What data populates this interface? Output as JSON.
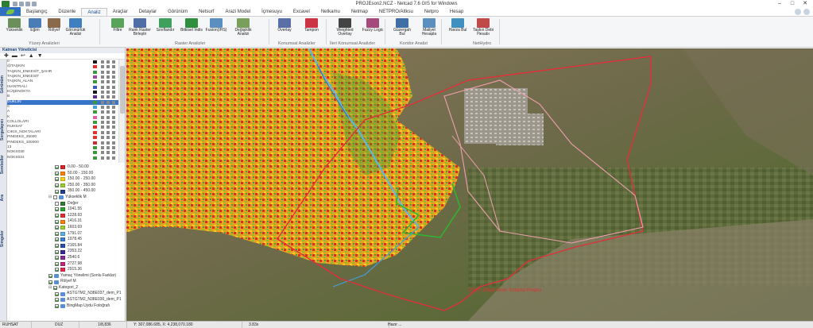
{
  "window": {
    "title": "PROJEson2.NCZ - Netcad 7.6 GIS for Windows"
  },
  "menu": {
    "tabs": [
      "Başlangıç",
      "Düzenle",
      "Analiz",
      "Araçlar",
      "Detaylar",
      "Görünüm",
      "Netsurf",
      "Arazi Model",
      "İçmesuyu",
      "Excavel",
      "Netkamu",
      "Netmap",
      "NETPRO/Altksu",
      "Netpro",
      "Hesap"
    ],
    "active": "Analiz"
  },
  "ribbon": {
    "buttons": [
      {
        "label": "Yükseklik",
        "icon": "elevation-icon",
        "color": "#6b8e5a"
      },
      {
        "label": "Eğim",
        "icon": "slope-icon",
        "color": "#4a7db5"
      },
      {
        "label": "Rölyef",
        "icon": "relief-icon",
        "color": "#8a6a4a"
      },
      {
        "label": "Görünürlük Analizi",
        "icon": "visibility-icon",
        "color": "#3f7fbf"
      },
      {
        "label": "Filtre",
        "icon": "filter-icon",
        "color": "#5aa35a"
      },
      {
        "label": "Rank Raster Birleştir",
        "icon": "rank-icon",
        "color": "#4e6fa5"
      },
      {
        "label": "Sınıflandır",
        "icon": "classify-icon",
        "color": "#3f9f5f"
      },
      {
        "label": "Bitkisel İndis",
        "icon": "vegetation-icon",
        "color": "#2f8f3f"
      },
      {
        "label": "Fusion(IHS)",
        "icon": "fusion-icon",
        "color": "#5a8fbf"
      },
      {
        "label": "Değişiklik Analizi",
        "icon": "change-icon",
        "color": "#7a9f5a"
      },
      {
        "label": "Overlay",
        "icon": "overlay-icon",
        "color": "#5a6fa5"
      },
      {
        "label": "Tampon",
        "icon": "buffer-icon",
        "color": "#cc3344"
      },
      {
        "label": "Weighted Overlay",
        "icon": "weighted-overlay-icon",
        "color": "#444444"
      },
      {
        "label": "Fuzzy Logic",
        "icon": "fuzzy-logic-icon",
        "color": "#a54a7a"
      },
      {
        "label": "Güzergah Bul",
        "icon": "route-icon",
        "color": "#3f6fa5"
      },
      {
        "label": "Maliyet Hesapla",
        "icon": "cost-icon",
        "color": "#5a8fbf"
      },
      {
        "label": "Havza Bul",
        "icon": "basin-icon",
        "color": "#3f8fbf"
      },
      {
        "label": "Taşkın Debi Hesabı",
        "icon": "flood-icon",
        "color": "#bf4a4a"
      }
    ],
    "groups": [
      "Yüzey Analizleri",
      "Raster Analizler",
      "Konumsal Analizler",
      "İleri Konumsal Analizler",
      "Koridor Analizi",
      "NetHydro"
    ]
  },
  "panel": {
    "title": "Katman Yöneticisi",
    "tools": [
      "✚",
      "▬",
      "↩",
      "▲",
      "▼"
    ],
    "vtabs": [
      "Görünüm",
      "Sorgulayıcı",
      "Semboller",
      "Ara",
      "Simgeler"
    ],
    "layers": [
      {
        "name": "0",
        "color": "#1a1a1a"
      },
      {
        "name": "@TAŞKIN",
        "color": "#e03030"
      },
      {
        "name": "TAŞKIN_ENKESİT_ŞAHR",
        "color": "#3a9a3a"
      },
      {
        "name": "TAŞKIN_ENKESİT",
        "color": "#9a4a9a"
      },
      {
        "name": "TAŞKIN_ALAN",
        "color": "#3a9a3a"
      },
      {
        "name": "ISANTRALI",
        "color": "#3a5ac0"
      },
      {
        "name": "KÜŞENOKTA",
        "color": "#1a1a1a"
      },
      {
        "name": "B",
        "color": "#5a2a8a"
      },
      {
        "name": "DÜKLIN",
        "color": "#3a9a3a",
        "selected": true
      },
      {
        "name": "C",
        "color": "#40a0e0"
      },
      {
        "name": "A",
        "color": "#3a9a3a"
      },
      {
        "name": "K",
        "color": "#e060a0"
      },
      {
        "name": "COLLOLARI",
        "color": "#3a9a3a"
      },
      {
        "name": "RUHSAT",
        "color": "#e03030"
      },
      {
        "name": "CIKIS_NOKTALARI",
        "color": "#e03030"
      },
      {
        "name": "PINDEKS_25000",
        "color": "#e03030"
      },
      {
        "name": "PINDEKS_100000",
        "color": "#c03030"
      },
      {
        "name": "13",
        "color": "#3a9a3a"
      },
      {
        "name": "NOKS030",
        "color": "#3a9a3a"
      },
      {
        "name": "NOKS031",
        "color": "#3a9a3a"
      }
    ],
    "tree": [
      {
        "label": "0.00 - 50.00",
        "color": "#d62728",
        "cb": true,
        "indent": 8
      },
      {
        "label": "50.00 - 150.00",
        "color": "#ff7f0e",
        "cb": true,
        "indent": 8
      },
      {
        "label": "150.00 - 250.00",
        "color": "#f5d020",
        "cb": true,
        "indent": 8
      },
      {
        "label": "250.00 - 350.00",
        "color": "#9acd32",
        "cb": true,
        "indent": 8
      },
      {
        "label": "350.00 - 450.00",
        "color": "#1f3f8f",
        "cb": true,
        "indent": 8
      },
      {
        "label": "Yükseklik M",
        "cb": false,
        "indent": 0,
        "expander": "⊟",
        "icon": true
      },
      {
        "label": "Değer",
        "cb": false,
        "indent": 8,
        "colorbox": "#2e7d32"
      },
      {
        "label": "1041.55",
        "color": "#2ca02c",
        "cb": true,
        "indent": 8
      },
      {
        "label": "1228.93",
        "color": "#e03030",
        "cb": true,
        "indent": 8
      },
      {
        "label": "1416.31",
        "color": "#ff7f0e",
        "cb": true,
        "indent": 8
      },
      {
        "label": "1603.69",
        "color": "#9acd32",
        "cb": true,
        "indent": 8
      },
      {
        "label": "1791.07",
        "color": "#5ab0e0",
        "cb": true,
        "indent": 8
      },
      {
        "label": "1978.45",
        "color": "#3a7fd0",
        "cb": true,
        "indent": 8
      },
      {
        "label": "2165.84",
        "color": "#2a4fb0",
        "cb": true,
        "indent": 8
      },
      {
        "label": "2353.22",
        "color": "#3a2a9a",
        "cb": true,
        "indent": 8
      },
      {
        "label": "2540.6",
        "color": "#8a2a9a",
        "cb": true,
        "indent": 8
      },
      {
        "label": "2727.98",
        "color": "#c02a7a",
        "cb": true,
        "indent": 8
      },
      {
        "label": "2915.36",
        "color": "#e02a4a",
        "cb": true,
        "indent": 8
      },
      {
        "label": "Yamaç Yönelimi (Sonlu Farklar)",
        "cb": true,
        "indent": 0,
        "icon": true
      },
      {
        "label": "Rölyef M",
        "cb": true,
        "indent": 0,
        "icon": true
      },
      {
        "label": "Kategori_2",
        "cb": true,
        "indent": 0,
        "expander": "⊟"
      },
      {
        "label": "ASTGTM2_N38E037_dem_P1",
        "cb": true,
        "indent": 8,
        "icon": true
      },
      {
        "label": "ASTGTM2_N38E036_dem_P1",
        "cb": true,
        "indent": 8,
        "icon": true
      },
      {
        "label": "BingMap Uydu Fotoğrafı",
        "cb": true,
        "indent": 8,
        "icon": true
      }
    ]
  },
  "map": {
    "annotation": "DSİ 9. Bölge Sınırı Sırlama Projesi"
  },
  "status": {
    "layer": "RUHSAT",
    "mode": "DUZ",
    "scale": "1/8,836",
    "coords": "Y: 307,086.685, X: 4,238,070.180",
    "time": "3.83s",
    "state": "Hazır ..."
  }
}
